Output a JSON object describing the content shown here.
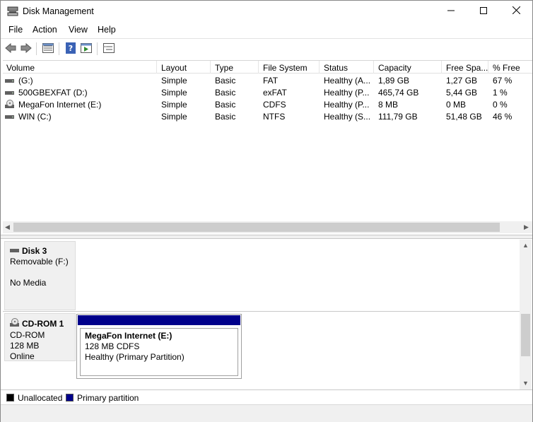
{
  "window": {
    "title": "Disk Management",
    "controls": {
      "minimize_icon": "minimize-icon",
      "maximize_icon": "maximize-icon",
      "close_icon": "close-icon"
    }
  },
  "menu": {
    "file": "File",
    "action": "Action",
    "view": "View",
    "help": "Help"
  },
  "toolbar": {
    "buttons": [
      "back-icon",
      "forward-icon",
      "list-view-icon",
      "help-icon",
      "run-icon",
      "properties-icon"
    ]
  },
  "volumes": {
    "headers": [
      "Volume",
      "Layout",
      "Type",
      "File System",
      "Status",
      "Capacity",
      "Free Spa...",
      "% Free"
    ],
    "rows": [
      {
        "volume": "(G:)",
        "layout": "Simple",
        "type": "Basic",
        "fs": "FAT",
        "status": "Healthy (A...",
        "capacity": "1,89 GB",
        "free": "1,27 GB",
        "pct": "67 %",
        "icon": "drive-icon"
      },
      {
        "volume": "500GBEXFAT (D:)",
        "layout": "Simple",
        "type": "Basic",
        "fs": "exFAT",
        "status": "Healthy (P...",
        "capacity": "465,74 GB",
        "free": "5,44 GB",
        "pct": "1 %",
        "icon": "drive-icon"
      },
      {
        "volume": "MegaFon Internet (E:)",
        "layout": "Simple",
        "type": "Basic",
        "fs": "CDFS",
        "status": "Healthy (P...",
        "capacity": "8 MB",
        "free": "0 MB",
        "pct": "0 %",
        "icon": "cd-drive-icon"
      },
      {
        "volume": "WIN (C:)",
        "layout": "Simple",
        "type": "Basic",
        "fs": "NTFS",
        "status": "Healthy (S...",
        "capacity": "111,79 GB",
        "free": "51,48 GB",
        "pct": "46 %",
        "icon": "drive-icon"
      }
    ]
  },
  "disks": {
    "disk3": {
      "name": "Disk 3",
      "line1": "Removable (F:)",
      "line2": "No Media"
    },
    "cdrom1": {
      "name": "CD-ROM 1",
      "line1": "CD-ROM",
      "line2": "128 MB",
      "line3": "Online",
      "partition": {
        "name": "MegaFon Internet  (E:)",
        "size": "128 MB CDFS",
        "status": "Healthy (Primary Partition)"
      }
    }
  },
  "legend": {
    "unallocated": "Unallocated",
    "primary": "Primary partition",
    "colors": {
      "unallocated": "#000000",
      "primary": "#00008b"
    }
  }
}
